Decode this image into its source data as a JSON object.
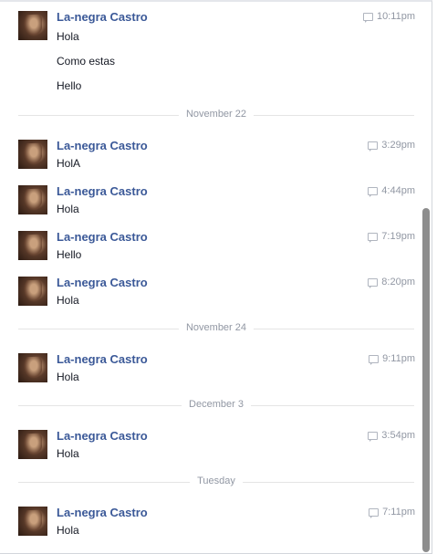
{
  "conversation": {
    "first_group": {
      "name": "La-negra Castro",
      "time": "10:11pm",
      "lines": [
        "Hola",
        "Como estas",
        "Hello"
      ]
    },
    "dividers": [
      "November 22",
      "November 24",
      "December 3",
      "Tuesday"
    ],
    "messages": [
      {
        "name": "La-negra Castro",
        "time": "3:29pm",
        "text": "HolA"
      },
      {
        "name": "La-negra Castro",
        "time": "4:44pm",
        "text": "Hola"
      },
      {
        "name": "La-negra Castro",
        "time": "7:19pm",
        "text": "Hello"
      },
      {
        "name": "La-negra Castro",
        "time": "8:20pm",
        "text": "Hola"
      },
      {
        "name": "La-negra Castro",
        "time": "9:11pm",
        "text": "Hola"
      },
      {
        "name": "La-negra Castro",
        "time": "3:54pm",
        "text": "Hola"
      },
      {
        "name": "La-negra Castro",
        "time": "7:11pm",
        "text": "Hola"
      }
    ]
  }
}
